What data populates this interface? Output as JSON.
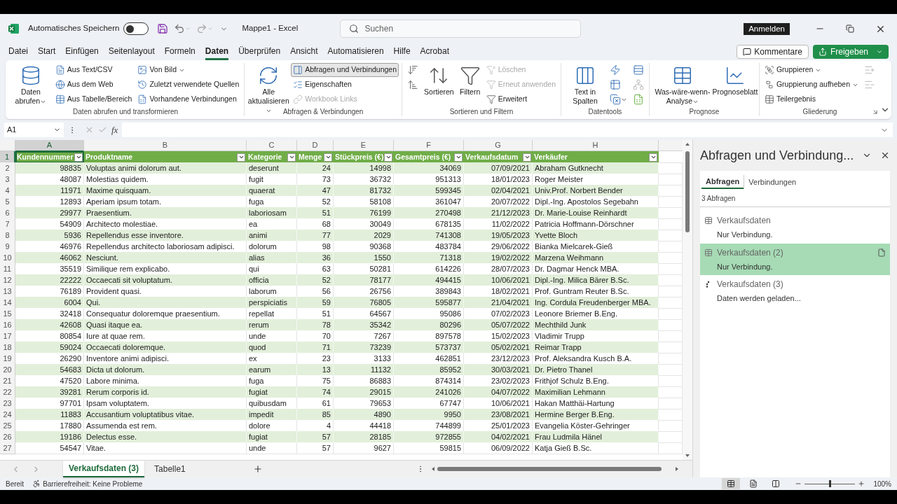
{
  "title_bar": {
    "autosave_label": "Automatisches Speichern",
    "autosave_on": false,
    "document": "Mappe1 - Excel",
    "search_placeholder": "Suchen",
    "sign_in": "Anmelden"
  },
  "menu_tabs": [
    {
      "label": "Datei",
      "selected": false
    },
    {
      "label": "Start",
      "selected": false
    },
    {
      "label": "Einfügen",
      "selected": false
    },
    {
      "label": "Seitenlayout",
      "selected": false
    },
    {
      "label": "Formeln",
      "selected": false
    },
    {
      "label": "Daten",
      "selected": true
    },
    {
      "label": "Überprüfen",
      "selected": false
    },
    {
      "label": "Ansicht",
      "selected": false
    },
    {
      "label": "Automatisieren",
      "selected": false
    },
    {
      "label": "Hilfe",
      "selected": false
    },
    {
      "label": "Acrobat",
      "selected": false
    }
  ],
  "comments_button": "Kommentare",
  "share_button": "Freigeben",
  "ribbon": [
    {
      "label": "Daten abrufen und transformieren",
      "columns": [
        [
          {
            "kind": "large",
            "label": "Daten abrufen",
            "dropdown": true,
            "disabled": false,
            "pressed": false
          }
        ],
        [
          {
            "kind": "small",
            "label": "Aus Text/CSV",
            "disabled": false,
            "pressed": false
          },
          {
            "kind": "small",
            "label": "Aus dem Web",
            "disabled": false,
            "pressed": false
          },
          {
            "kind": "small",
            "label": "Aus Tabelle/Bereich",
            "disabled": false,
            "pressed": false
          }
        ],
        [
          {
            "kind": "small",
            "label": "Von Bild",
            "dropdown": true,
            "disabled": false,
            "pressed": false
          },
          {
            "kind": "small",
            "label": "Zuletzt verwendete Quellen",
            "disabled": false,
            "pressed": false
          },
          {
            "kind": "small",
            "label": "Vorhandene Verbindungen",
            "disabled": false,
            "pressed": false
          }
        ]
      ]
    },
    {
      "label": "Abfragen & Verbindungen",
      "columns": [
        [
          {
            "kind": "large",
            "label": "Alle aktualisieren",
            "dropdown": true,
            "disabled": false,
            "pressed": false
          }
        ],
        [
          {
            "kind": "small",
            "label": "Abfragen und Verbindungen",
            "disabled": false,
            "pressed": true
          },
          {
            "kind": "small",
            "label": "Eigenschaften",
            "disabled": false,
            "pressed": false
          },
          {
            "kind": "small",
            "label": "Workbook Links",
            "disabled": true,
            "pressed": false
          }
        ]
      ]
    },
    {
      "label": "Sortieren und Filtern",
      "columns": [
        [
          {
            "kind": "icon",
            "disabled": false,
            "pressed": false
          },
          {
            "kind": "icon",
            "disabled": false,
            "pressed": false
          }
        ],
        [
          {
            "kind": "large",
            "label": "Sortieren",
            "disabled": false,
            "pressed": false
          }
        ],
        [
          {
            "kind": "large",
            "label": "Filtern",
            "disabled": false,
            "pressed": false
          }
        ],
        [
          {
            "kind": "small",
            "label": "Löschen",
            "disabled": true,
            "pressed": false
          },
          {
            "kind": "small",
            "label": "Erneut anwenden",
            "disabled": true,
            "pressed": false
          },
          {
            "kind": "small",
            "label": "Erweitert",
            "disabled": false,
            "pressed": false
          }
        ]
      ]
    },
    {
      "label": "Datentools",
      "columns": [
        [
          {
            "kind": "large",
            "label": "Text in Spalten",
            "disabled": false,
            "pressed": false
          }
        ],
        [
          {
            "kind": "icon",
            "disabled": false,
            "pressed": false
          },
          {
            "kind": "icon",
            "disabled": false,
            "pressed": false
          },
          {
            "kind": "icon",
            "dropdown": true,
            "disabled": false,
            "pressed": false
          }
        ],
        [
          {
            "kind": "icon",
            "disabled": false,
            "pressed": false
          },
          {
            "kind": "icon",
            "disabled": true,
            "pressed": false
          },
          {
            "kind": "icon",
            "disabled": false,
            "pressed": false
          }
        ]
      ]
    },
    {
      "label": "Prognose",
      "columns": [
        [
          {
            "kind": "large",
            "label": "Was-wäre-wenn-Analyse",
            "dropdown": true,
            "disabled": false,
            "pressed": false
          }
        ],
        [
          {
            "kind": "large",
            "label": "Prognoseblatt",
            "disabled": false,
            "pressed": false
          }
        ]
      ]
    },
    {
      "label": "Gliederung",
      "launcher": true,
      "columns": [
        [
          {
            "kind": "small",
            "label": "Gruppieren",
            "dropdown": true,
            "disabled": false,
            "pressed": false
          },
          {
            "kind": "small",
            "label": "Gruppierung aufheben",
            "dropdown": true,
            "disabled": false,
            "pressed": false
          },
          {
            "kind": "small",
            "label": "Teilergebnis",
            "disabled": false,
            "pressed": false
          }
        ],
        [
          {
            "kind": "icon",
            "disabled": true,
            "pressed": false
          },
          {
            "kind": "icon",
            "disabled": true,
            "pressed": false
          }
        ]
      ]
    }
  ],
  "formula_bar": {
    "name_box": "A1",
    "function_label": "fx"
  },
  "sheet": {
    "column_letters": [
      {
        "label": "A",
        "selected": true
      },
      {
        "label": "B",
        "selected": false
      },
      {
        "label": "C",
        "selected": false
      },
      {
        "label": "D",
        "selected": false
      },
      {
        "label": "E",
        "selected": false
      },
      {
        "label": "F",
        "selected": false
      },
      {
        "label": "G",
        "selected": false
      },
      {
        "label": "H",
        "selected": false
      }
    ],
    "header_row": {
      "number": "1",
      "selected": true
    },
    "columns": [
      {
        "label": "Kundennummer",
        "kind": "number"
      },
      {
        "label": "Produktname",
        "kind": "text"
      },
      {
        "label": "Kategorie",
        "kind": "text"
      },
      {
        "label": "Menge",
        "kind": "number"
      },
      {
        "label": "Stückpreis (€)",
        "kind": "number"
      },
      {
        "label": "Gesamtpreis (€)",
        "kind": "number"
      },
      {
        "label": "Verkaufsdatum",
        "kind": "number"
      },
      {
        "label": "Verkäufer",
        "kind": "text"
      }
    ],
    "rows": [
      {
        "number": "2",
        "selected": false,
        "cells": [
          "98835",
          "Voluptas animi dolorum aut.",
          "deserunt",
          "24",
          "14998",
          "34069",
          "07/09/2021",
          "Abraham Gutknecht"
        ]
      },
      {
        "number": "3",
        "selected": false,
        "cells": [
          "48087",
          "Molestias quidem.",
          "fugit",
          "73",
          "36732",
          "951313",
          "18/01/2023",
          "Roger Meister"
        ]
      },
      {
        "number": "4",
        "selected": false,
        "cells": [
          "11971",
          "Maxime quisquam.",
          "quaerat",
          "47",
          "81732",
          "599345",
          "02/04/2021",
          "Univ.Prof. Norbert Bender"
        ]
      },
      {
        "number": "5",
        "selected": false,
        "cells": [
          "12893",
          "Aperiam ipsum totam.",
          "fuga",
          "52",
          "58108",
          "361047",
          "20/07/2022",
          "Dipl.-Ing. Apostolos Segebahn"
        ]
      },
      {
        "number": "6",
        "selected": false,
        "cells": [
          "29977",
          "Praesentium.",
          "laboriosam",
          "51",
          "76199",
          "270498",
          "21/12/2023",
          "Dr. Marie-Louise Reinhardt"
        ]
      },
      {
        "number": "7",
        "selected": false,
        "cells": [
          "54909",
          "Architecto molestiae.",
          "ea",
          "68",
          "30049",
          "678135",
          "11/02/2022",
          "Patricia Hoffmann-Dörschner"
        ]
      },
      {
        "number": "8",
        "selected": false,
        "cells": [
          "5936",
          "Repellendus esse inventore.",
          "animi",
          "77",
          "2029",
          "741308",
          "19/05/2023",
          "Yvette Bloch"
        ]
      },
      {
        "number": "9",
        "selected": false,
        "cells": [
          "46976",
          "Repellendus architecto laboriosam adipisci.",
          "dolorum",
          "98",
          "90368",
          "483784",
          "29/06/2022",
          "Bianka Mielcarek-Gieß"
        ]
      },
      {
        "number": "10",
        "selected": false,
        "cells": [
          "46062",
          "Nesciunt.",
          "alias",
          "36",
          "1550",
          "71318",
          "19/02/2022",
          "Marzena Weihmann"
        ]
      },
      {
        "number": "11",
        "selected": false,
        "cells": [
          "35519",
          "Similique rem explicabo.",
          "qui",
          "63",
          "50281",
          "614226",
          "28/07/2023",
          "Dr. Dagmar Henck MBA."
        ]
      },
      {
        "number": "12",
        "selected": false,
        "cells": [
          "22222",
          "Occaecati sit voluptatum.",
          "officia",
          "52",
          "78177",
          "494415",
          "10/06/2021",
          "Dipl.-Ing. Milica Bärer B.Sc."
        ]
      },
      {
        "number": "13",
        "selected": false,
        "cells": [
          "76189",
          "Provident quasi.",
          "laborum",
          "56",
          "26756",
          "389843",
          "18/02/2021",
          "Prof. Guntram Reuter B.Sc."
        ]
      },
      {
        "number": "14",
        "selected": false,
        "cells": [
          "6004",
          "Qui.",
          "perspiciatis",
          "59",
          "76805",
          "595877",
          "21/04/2021",
          "Ing. Cordula Freudenberger MBA."
        ]
      },
      {
        "number": "15",
        "selected": false,
        "cells": [
          "32418",
          "Consequatur doloremque praesentium.",
          "repellat",
          "51",
          "64567",
          "95086",
          "07/02/2023",
          "Leonore Briemer B.Eng."
        ]
      },
      {
        "number": "16",
        "selected": false,
        "cells": [
          "42608",
          "Quasi itaque ea.",
          "rerum",
          "78",
          "35342",
          "80296",
          "05/07/2022",
          "Mechthild Junk"
        ]
      },
      {
        "number": "17",
        "selected": false,
        "cells": [
          "80854",
          "Iure at quae rem.",
          "unde",
          "70",
          "7267",
          "897578",
          "15/02/2023",
          "Vladimir Trupp"
        ]
      },
      {
        "number": "18",
        "selected": false,
        "cells": [
          "59024",
          "Occaecati doloremque.",
          "quod",
          "71",
          "73239",
          "573737",
          "05/02/2021",
          "Reimar Trapp"
        ]
      },
      {
        "number": "19",
        "selected": false,
        "cells": [
          "26290",
          "Inventore animi adipisci.",
          "ex",
          "23",
          "3133",
          "462851",
          "23/12/2023",
          "Prof. Aleksandra Kusch B.A."
        ]
      },
      {
        "number": "20",
        "selected": false,
        "cells": [
          "54683",
          "Dicta ut dolorum.",
          "earum",
          "13",
          "11132",
          "85952",
          "30/03/2021",
          "Dr. Pietro Thanel"
        ]
      },
      {
        "number": "21",
        "selected": false,
        "cells": [
          "47520",
          "Labore minima.",
          "fuga",
          "75",
          "86883",
          "874314",
          "23/02/2023",
          "Frithjof Schulz B.Eng."
        ]
      },
      {
        "number": "22",
        "selected": false,
        "cells": [
          "39281",
          "Rerum corporis id.",
          "fugiat",
          "74",
          "29015",
          "241026",
          "04/07/2022",
          "Maximilian Lehmann"
        ]
      },
      {
        "number": "23",
        "selected": false,
        "cells": [
          "97701",
          "Ipsam voluptatem.",
          "quibusdam",
          "61",
          "79653",
          "67747",
          "10/06/2021",
          "Hakan Matthäi-Hartung"
        ]
      },
      {
        "number": "24",
        "selected": false,
        "cells": [
          "11883",
          "Accusantium voluptatibus vitae.",
          "impedit",
          "85",
          "4890",
          "9950",
          "23/08/2021",
          "Hermine Berger B.Eng."
        ]
      },
      {
        "number": "25",
        "selected": false,
        "cells": [
          "17880",
          "Assumenda est rem.",
          "dolore",
          "4",
          "44418",
          "744899",
          "25/01/2023",
          "Evangelia Köster-Gehringer"
        ]
      },
      {
        "number": "26",
        "selected": false,
        "cells": [
          "19186",
          "Delectus esse.",
          "fugiat",
          "57",
          "28185",
          "972855",
          "04/02/2021",
          "Frau Ludmila Hänel"
        ]
      },
      {
        "number": "27",
        "selected": false,
        "cells": [
          "54547",
          "Vitae.",
          "unde",
          "57",
          "9627",
          "59815",
          "06/09/2022",
          "Katja Gieß B.Sc."
        ]
      }
    ]
  },
  "sheet_tabs": [
    {
      "label": "Verkaufsdaten (3)",
      "selected": true
    },
    {
      "label": "Tabelle1",
      "selected": false
    }
  ],
  "queries_pane": {
    "title": "Abfragen und Verbindung...",
    "tabs": [
      {
        "label": "Abfragen",
        "selected": true
      },
      {
        "label": "Verbindungen",
        "selected": false
      }
    ],
    "count": "3 Abfragen",
    "queries": [
      {
        "name": "Verkaufsdaten",
        "status": "Nur Verbindung.",
        "kind": "table",
        "selected": false
      },
      {
        "name": "Verkaufsdaten (2)",
        "status": "Nur Verbindung.",
        "kind": "table",
        "selected": true
      },
      {
        "name": "Verkaufsdaten (3)",
        "status": "Daten werden geladen...",
        "kind": "loading",
        "selected": false
      }
    ]
  },
  "status_bar": {
    "ready": "Bereit",
    "accessibility": "Barrierefreiheit: Keine Probleme",
    "views": [
      {
        "selected": true
      },
      {
        "selected": false
      },
      {
        "selected": false
      }
    ],
    "zoom": {
      "level": 0.5,
      "reading": "100%"
    }
  }
}
